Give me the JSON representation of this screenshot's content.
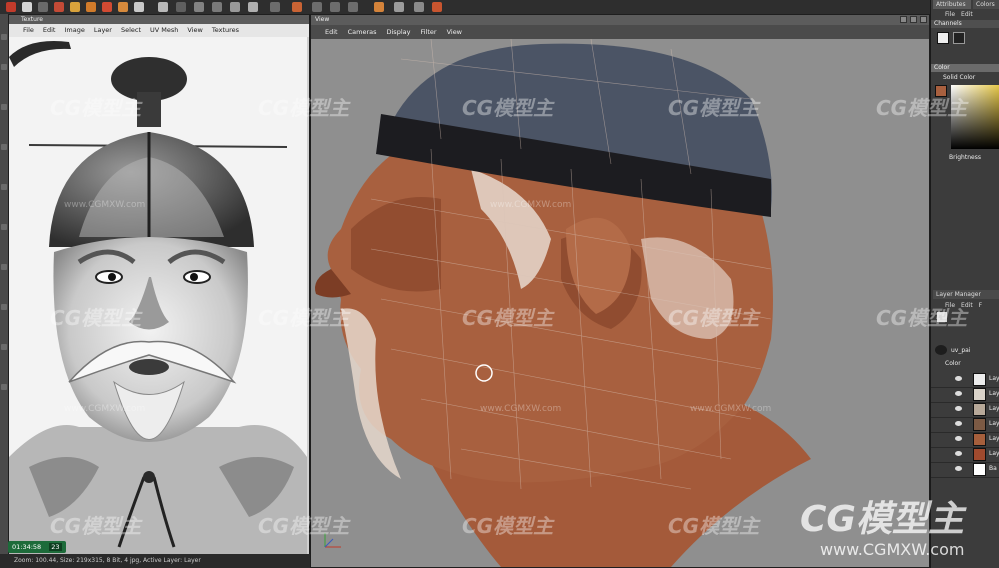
{
  "texture_window": {
    "title": "Texture",
    "menu": [
      "File",
      "Edit",
      "Image",
      "Layer",
      "Select",
      "UV Mesh",
      "View",
      "Textures"
    ]
  },
  "viewport": {
    "title": "View",
    "menu": [
      "Edit",
      "Cameras",
      "Display",
      "Filter",
      "View"
    ]
  },
  "right_panel": {
    "attributes_tab": "Attributes",
    "colors_tab": "Colors",
    "file_edit_menu": [
      "File",
      "Edit"
    ],
    "channels_label": "Channels",
    "color_header": "Color",
    "solid_color_label": "Solid Color",
    "brightness_label": "Brightness",
    "layer_manager_header": "Layer Manager",
    "layer_menu": [
      "File",
      "Edit",
      "F"
    ],
    "color_channel_label": "Color",
    "uv_label": "uv_pai",
    "layer_names": [
      "Lay",
      "Lay",
      "Lay",
      "Lay",
      "Lay",
      "Lay",
      "Ba"
    ],
    "layer_colors": [
      "#ececec",
      "#d9d2c8",
      "#b8a999",
      "#7c5a44",
      "#a65f3c",
      "#a04a2e",
      "#ffffff"
    ]
  },
  "status": {
    "timer": "01:34:58",
    "timer_extra": "23",
    "info": "Zoom: 100.44, Size: 219x315, 8 Bit, 4 jpg, Active Layer: Layer"
  },
  "watermarks": {
    "logo_text": "CG模型主",
    "url": "www.CGMXW.com"
  },
  "colors": {
    "skin": "#a0593a",
    "hat": "#4a5363",
    "hat_band": "#1b1b1e",
    "viewport_bg": "#8f8f8f"
  }
}
